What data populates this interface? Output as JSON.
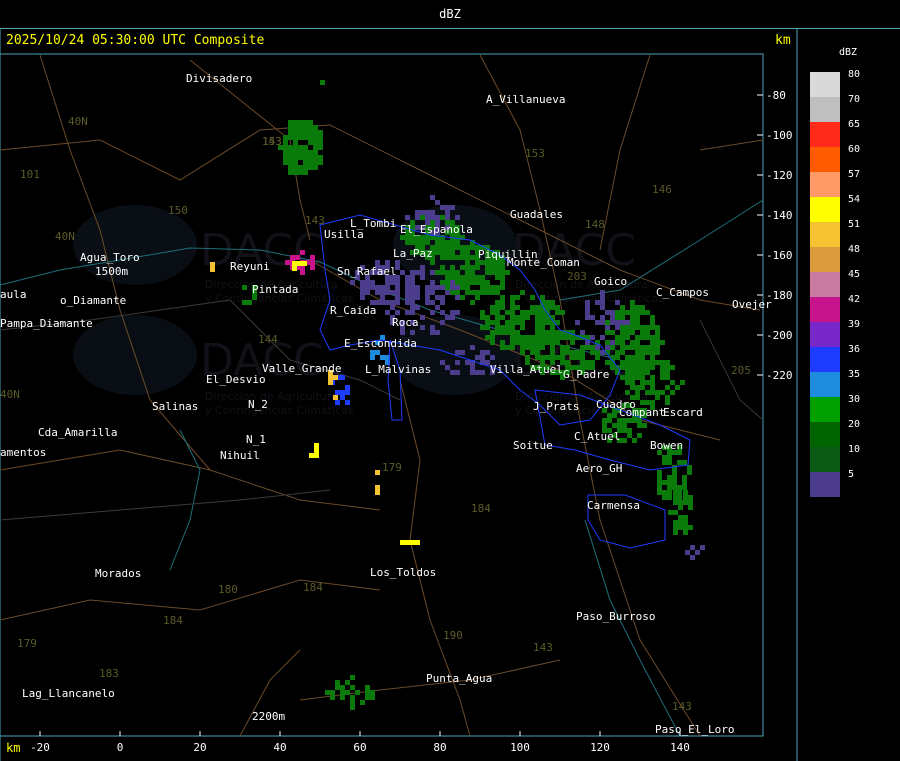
{
  "header": {
    "title": "dBZ"
  },
  "map": {
    "subtitle": "2025/10/24 05:30:00 UTC Composite",
    "unit": "km",
    "x_ticks": [
      "-20",
      "0",
      "20",
      "40",
      "60",
      "80",
      "100",
      "120",
      "140"
    ],
    "y_ticks": [
      "-80",
      "-100",
      "-120",
      "-140",
      "-160",
      "-180",
      "-200",
      "-220"
    ],
    "places": [
      {
        "name": "Divisadero"
      },
      {
        "name": "A_Villanueva"
      },
      {
        "name": "Guadales"
      },
      {
        "name": "Usilla"
      },
      {
        "name": "L_Tombi"
      },
      {
        "name": "El_Espanola"
      },
      {
        "name": "Agua_Toro"
      },
      {
        "name": "1500m"
      },
      {
        "name": "Reyuni"
      },
      {
        "name": "Pintada"
      },
      {
        "name": "Sn_Rafael"
      },
      {
        "name": "La_Paz"
      },
      {
        "name": "Piquillin"
      },
      {
        "name": "Monte_Coman"
      },
      {
        "name": "Goico"
      },
      {
        "name": "C_Campos"
      },
      {
        "name": "Ovejer"
      },
      {
        "name": "Pampa_Diamante"
      },
      {
        "name": "o_Diamante"
      },
      {
        "name": "aula"
      },
      {
        "name": "R_Caida"
      },
      {
        "name": "Roca"
      },
      {
        "name": "E_Escondida"
      },
      {
        "name": "L_Malvinas"
      },
      {
        "name": "Valle_Grande"
      },
      {
        "name": "El_Desvio"
      },
      {
        "name": "Salinas"
      },
      {
        "name": "N_2"
      },
      {
        "name": "N_1"
      },
      {
        "name": "Nihuil"
      },
      {
        "name": "Cda_Amarilla"
      },
      {
        "name": "amentos"
      },
      {
        "name": "Villa_Atuel"
      },
      {
        "name": "J_Prats"
      },
      {
        "name": "G_Padre"
      },
      {
        "name": "Compant"
      },
      {
        "name": "Escard"
      },
      {
        "name": "C_Atuel"
      },
      {
        "name": "Soitue"
      },
      {
        "name": "Aero_GH"
      },
      {
        "name": "Bowen"
      },
      {
        "name": "Carmensa"
      },
      {
        "name": "Morados"
      },
      {
        "name": "Los_Toldos"
      },
      {
        "name": "Paso_Burroso"
      },
      {
        "name": "Punta_Agua"
      },
      {
        "name": "Lag_Llancanelo"
      },
      {
        "name": "2200m"
      },
      {
        "name": "Paso_El_Loro"
      },
      {
        "name": "Cuadro"
      }
    ],
    "route_numbers": [
      "153",
      "143",
      "40N",
      "40N",
      "101",
      "150",
      "143",
      "153",
      "146",
      "148",
      "203",
      "205",
      "144",
      "179",
      "184",
      "180",
      "184",
      "184",
      "183",
      "179",
      "190",
      "143",
      "143",
      "40N"
    ],
    "watermark": {
      "name": "DACC",
      "line1": "Dirección de Agricultura",
      "line2": "y Contingencias Climáticas"
    }
  },
  "legend": {
    "title": "dBZ",
    "levels": [
      {
        "value": "80",
        "color": "#d9d9d9"
      },
      {
        "value": "70",
        "color": "#bfbfbf"
      },
      {
        "value": "65",
        "color": "#ff2a1a"
      },
      {
        "value": "60",
        "color": "#ff5a00"
      },
      {
        "value": "57",
        "color": "#ff9966"
      },
      {
        "value": "54",
        "color": "#ffff00"
      },
      {
        "value": "51",
        "color": "#f5c332"
      },
      {
        "value": "48",
        "color": "#d99b3c"
      },
      {
        "value": "45",
        "color": "#c87aa0"
      },
      {
        "value": "42",
        "color": "#c8148c"
      },
      {
        "value": "39",
        "color": "#7828c8"
      },
      {
        "value": "36",
        "color": "#1e3cff"
      },
      {
        "value": "35",
        "color": "#1e8cdc"
      },
      {
        "value": "30",
        "color": "#00a000"
      },
      {
        "value": "20",
        "color": "#006400"
      },
      {
        "value": "10",
        "color": "#0a5a14"
      },
      {
        "value": "5",
        "color": "#4b3c8c"
      }
    ]
  }
}
